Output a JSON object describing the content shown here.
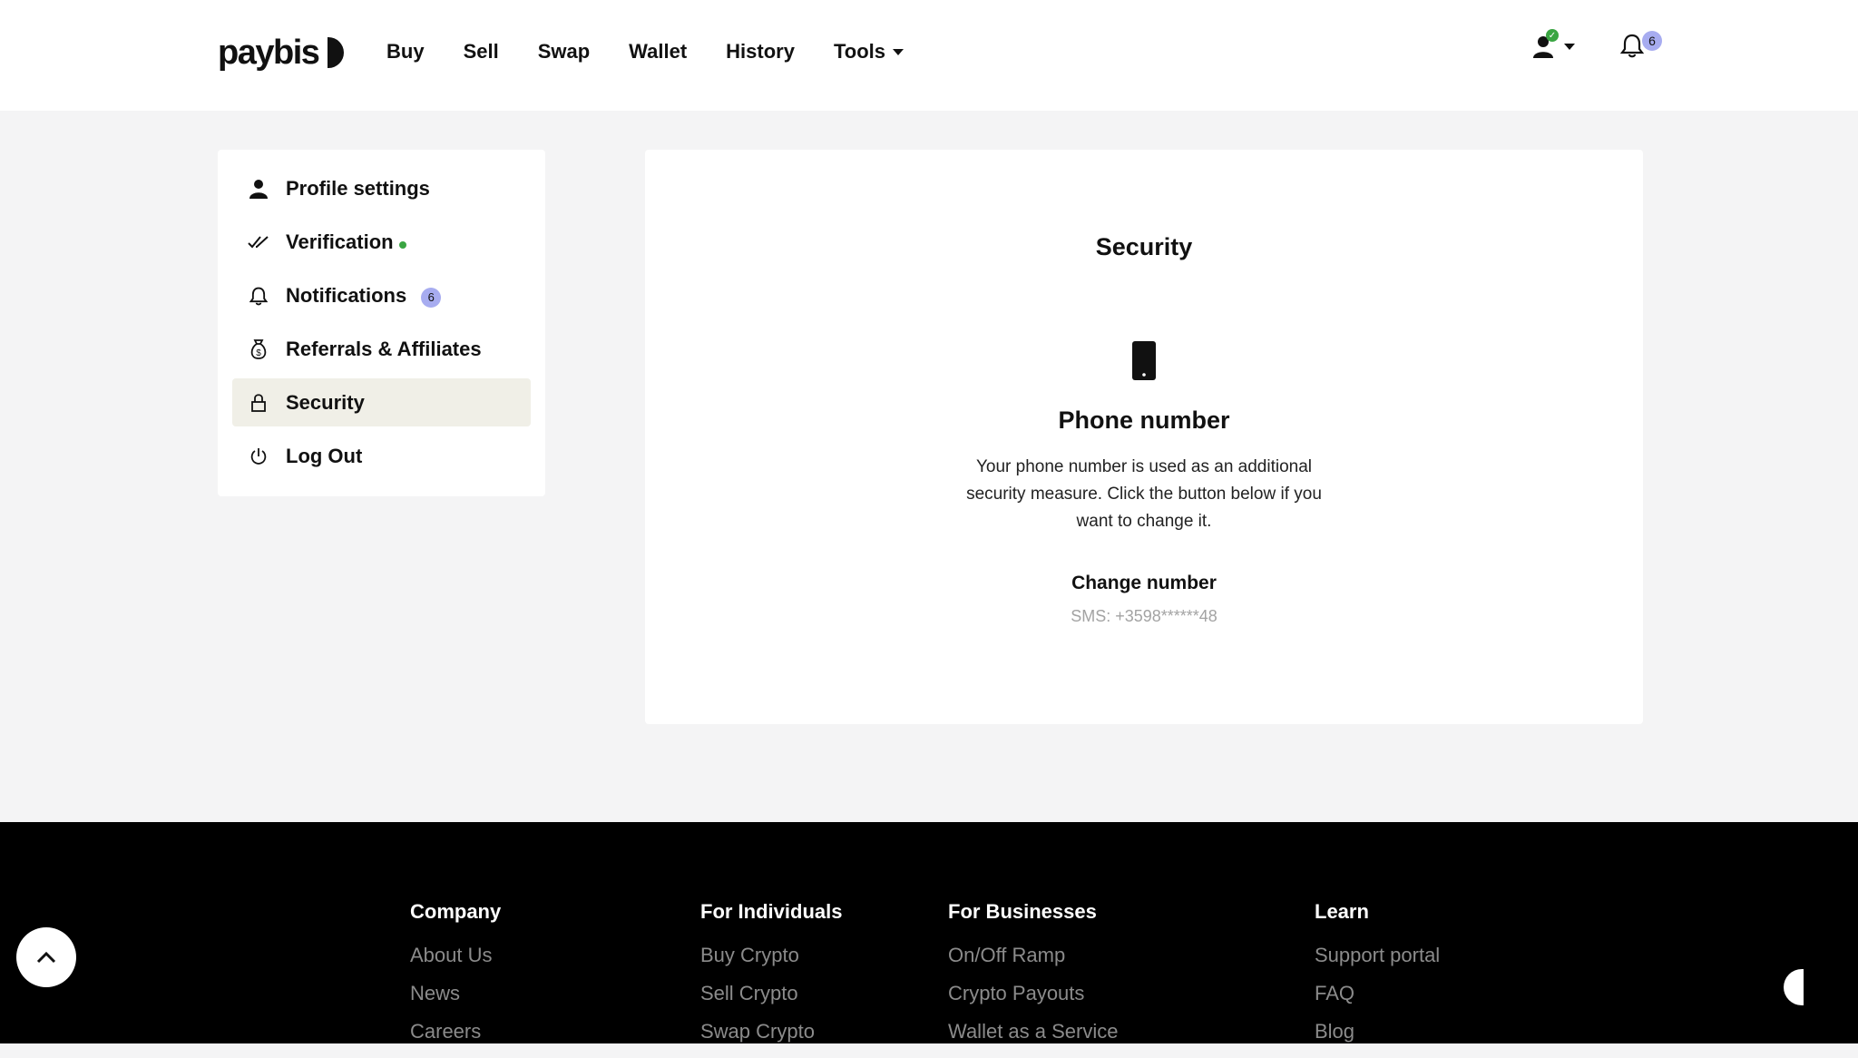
{
  "brand": {
    "name": "paybis"
  },
  "nav": {
    "items": [
      {
        "label": "Buy"
      },
      {
        "label": "Sell"
      },
      {
        "label": "Swap"
      },
      {
        "label": "Wallet"
      },
      {
        "label": "History"
      },
      {
        "label": "Tools"
      }
    ]
  },
  "header": {
    "notification_count": "6"
  },
  "sidebar": {
    "items": [
      {
        "label": "Profile settings",
        "icon": "user-icon"
      },
      {
        "label": "Verification",
        "icon": "double-check-icon"
      },
      {
        "label": "Notifications",
        "icon": "bell-icon",
        "badge": "6"
      },
      {
        "label": "Referrals & Affiliates",
        "icon": "money-bag-icon"
      },
      {
        "label": "Security",
        "icon": "lock-icon",
        "active": true
      },
      {
        "label": "Log Out",
        "icon": "power-icon"
      }
    ]
  },
  "security": {
    "title": "Security",
    "phone_heading": "Phone number",
    "description": "Your phone number is used as an additional security measure. Click the button below if you want to change it.",
    "change_label": "Change number",
    "sms_value": "SMS: +3598******48"
  },
  "footer": {
    "columns": [
      {
        "heading": "Company",
        "links": [
          "About Us",
          "News",
          "Careers"
        ]
      },
      {
        "heading": "For Individuals",
        "links": [
          "Buy Crypto",
          "Sell Crypto",
          "Swap Crypto"
        ]
      },
      {
        "heading": "For Businesses",
        "links": [
          "On/Off Ramp",
          "Crypto Payouts",
          "Wallet as a Service"
        ]
      },
      {
        "heading": "Learn",
        "links": [
          "Support portal",
          "FAQ",
          "Blog"
        ]
      }
    ]
  },
  "colors": {
    "accent_badge": "#a7acf0",
    "verified_green": "#3aa542",
    "active_bg": "#f0efe7",
    "footer_bg": "#000000"
  }
}
